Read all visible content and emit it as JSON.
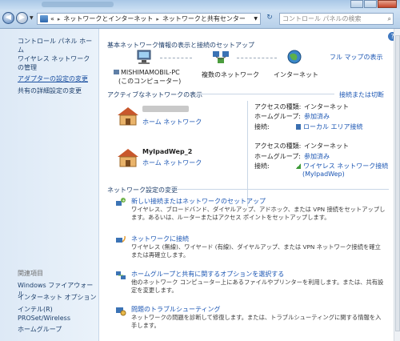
{
  "address": {
    "prefix": "«",
    "crumbs": [
      "ネットワークとインターネット",
      "ネットワークと共有センター"
    ],
    "search_placeholder": "コントロール パネルの検索"
  },
  "sidebar": {
    "items": [
      {
        "label": "コントロール パネル ホーム"
      },
      {
        "label": "ワイヤレス ネットワークの管理"
      },
      {
        "label": "アダプターの設定の変更"
      },
      {
        "label": "共有の詳細設定の変更"
      }
    ],
    "see_also_header": "関連項目",
    "see_also": [
      {
        "label": "Windows ファイアウォール"
      },
      {
        "label": "インターネット オプション"
      },
      {
        "label": "インテル(R) PROSet/Wireless"
      },
      {
        "label": "ホームグループ"
      }
    ]
  },
  "main": {
    "header": "基本ネットワーク情報の表示と接続のセットアップ",
    "full_map_link": "フル マップの表示",
    "map": {
      "computer_name": "MISHIMAMOBIL-PC",
      "computer_sub": "(このコンピューター)",
      "network_label": "複数のネットワーク",
      "internet_label": "インターネット"
    },
    "active_header": "アクティブなネットワークの表示",
    "connect_disconnect": "接続または切断",
    "networks": [
      {
        "name": "",
        "type": "ホーム ネットワーク",
        "access_type_label": "アクセスの種類:",
        "access_type": "インターネット",
        "homegroup_label": "ホームグループ:",
        "homegroup": "参加済み",
        "connection_label": "接続:",
        "connection": "ローカル エリア接続"
      },
      {
        "name": "MyIpadWep_2",
        "type": "ホーム ネットワーク",
        "access_type_label": "アクセスの種類:",
        "access_type": "インターネット",
        "homegroup_label": "ホームグループ:",
        "homegroup": "参加済み",
        "connection_label": "接続:",
        "connection": "ワイヤレス ネットワーク接続",
        "connection_sub": "(MyIpadWep)"
      }
    ],
    "change_header": "ネットワーク設定の変更",
    "tasks": [
      {
        "title": "新しい接続またはネットワークのセットアップ",
        "desc1": "ワイヤレス、ブロードバンド、ダイヤルアップ、アドホック、または VPN 接続をセットアップし",
        "desc2": "ます。あるいは、ルーターまたはアクセス ポイントをセットアップします。"
      },
      {
        "title": "ネットワークに接続",
        "desc1": "ワイヤレス (無線)、ワイヤード (有線)、ダイヤルアップ、または VPN ネットワーク接続を確立",
        "desc2": "または再確立します。"
      },
      {
        "title": "ホームグループと共有に関するオプションを選択する",
        "desc1": "他のネットワーク コンピューター上にあるファイルやプリンターを利用します。または、共有設",
        "desc2": "定を変更します。"
      },
      {
        "title": "問題のトラブルシューティング",
        "desc1": "ネットワークの問題を診断して修復します。または、トラブルシューティングに関する情報を入",
        "desc2": "手します。"
      }
    ]
  }
}
